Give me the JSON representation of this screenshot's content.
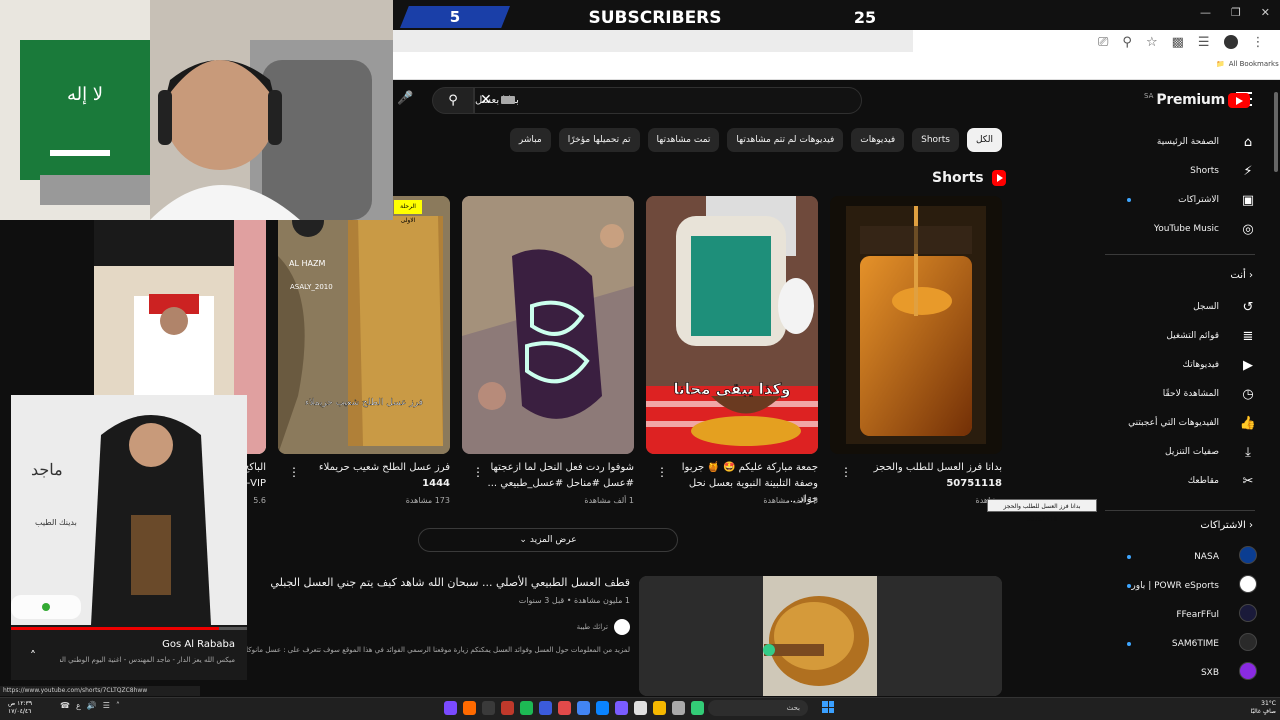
{
  "overlay": {
    "sub_left": "5",
    "sub_title": "SUBSCRIBERS",
    "sub_right": "25"
  },
  "browser": {
    "bookmarks_label": "All Bookmarks",
    "status_url": "https://www.youtube.com/shorts/7CLTQZC8hww"
  },
  "youtube": {
    "logo_text": "Premium",
    "logo_region": "SA",
    "search_query": "بدانا بعسل",
    "chips": [
      "الكل",
      "Shorts",
      "فيديوهات",
      "فيديوهات لم تتم مشاهدتها",
      "تمت مشاهدتها",
      "تم تحميلها مؤخرًا",
      "مباشر"
    ],
    "active_chip": 0,
    "shorts_heading": "Shorts",
    "show_more": "عرض المزيد",
    "tooltip": "بدانا فرز العسل للطلب والحجز 50751118"
  },
  "sidebar": {
    "main": [
      {
        "label": "الصفحة الرئيسية",
        "icon": "home-icon"
      },
      {
        "label": "Shorts",
        "icon": "shorts-icon"
      },
      {
        "label": "الاشتراكات",
        "icon": "subscriptions-icon"
      },
      {
        "label": "YouTube Music",
        "icon": "music-icon"
      }
    ],
    "you_heading": "أنت",
    "you_items": [
      {
        "label": "السجل",
        "icon": "history-icon"
      },
      {
        "label": "قوائم التشغيل",
        "icon": "playlist-icon"
      },
      {
        "label": "فيديوهاتك",
        "icon": "your-videos-icon"
      },
      {
        "label": "المشاهدة لاحقًا",
        "icon": "watch-later-icon"
      },
      {
        "label": "الفيديوهات التي أعجبتني",
        "icon": "like-icon"
      },
      {
        "label": "صفيات التنزيل",
        "icon": "download-icon"
      },
      {
        "label": "مقاطعك",
        "icon": "clips-icon"
      }
    ],
    "subs_heading": "الاشتراكات",
    "subscriptions": [
      {
        "label": "NASA",
        "color": "#0b3d91",
        "live": true
      },
      {
        "label": "باور | POWR eSports",
        "color": "#ffffff",
        "live": false
      },
      {
        "label": "FFearFFul",
        "color": "#1a1a3a",
        "live": false
      },
      {
        "label": "SAM6TIME",
        "color": "#2a2a2a",
        "live": false
      },
      {
        "label": "SXB",
        "color": "#8a2be2",
        "live": false
      }
    ]
  },
  "shorts": [
    {
      "title_line1": "بدانا فرز العسل للطلب والحجز",
      "title_line2": "50751118",
      "views": "مشاهدة"
    },
    {
      "title_line1": "جمعة مباركة عليكم 🤩 🍯 جربوا",
      "title_line2": "وصفة التلبينة النبوية بعسل نحل جواد ...",
      "views": "18 ألف مشاهدة"
    },
    {
      "title_line1": "شوفوا ردت فعل النحل لما ازعجتها",
      "title_line2": "#عسل #مناحل #عسل_طبيعي ...",
      "views": "1 ألف مشاهدة"
    },
    {
      "title_line1": "فرز عسل الطلح شعيب حريملاء",
      "title_line2": "1444",
      "views": "173 مشاهدة"
    },
    {
      "title_line1": "الباكح",
      "title_line2": "VIP-",
      "views": "5.6"
    }
  ],
  "short_overlays": {
    "card2_caption": "وكذا يبقى محانا",
    "card4_caption": "فرز عسل الطلح شعيب حريملاء",
    "card4_handle1": "AL HAZM",
    "card4_handle2": "ASALY_2010",
    "card4_badge": "الرحلة الاولى"
  },
  "video": {
    "title": "قطف العسل الطبيعي الأصلي ... سبحان الله شاهد كيف يتم جني العسل الجبلي",
    "meta": "1 مليون مشاهدة • قبل 3 سنوات",
    "channel": "تراثك طيبة",
    "description": "لمزيد من المعلومات حول العسل وفوائد العسل يمكنكم زيارة موقعنا الرسمي الفوائد في هذا الموقع سوف تتعرف على : عسل مانوكا عسل السدر"
  },
  "music": {
    "artist": "Gos Al Rababa",
    "song": "ميكس الله يعز الدار - ماجد المهندس - اغنية اليوم الوطني السعـ",
    "progress": 0.88,
    "art_text": "بدينك الطيب"
  },
  "taskbar": {
    "search_placeholder": "بحث",
    "clock": "١٢:٣٩ ص",
    "date": "١٧/٠٤/٤٦",
    "temp": "31°C",
    "weather": "صافٍ غالبًا",
    "lang": "ع"
  },
  "colors": {
    "yt_red": "#ff0000",
    "subs_blue": "#1a3fa8",
    "live_dot": "#3ea6ff"
  }
}
